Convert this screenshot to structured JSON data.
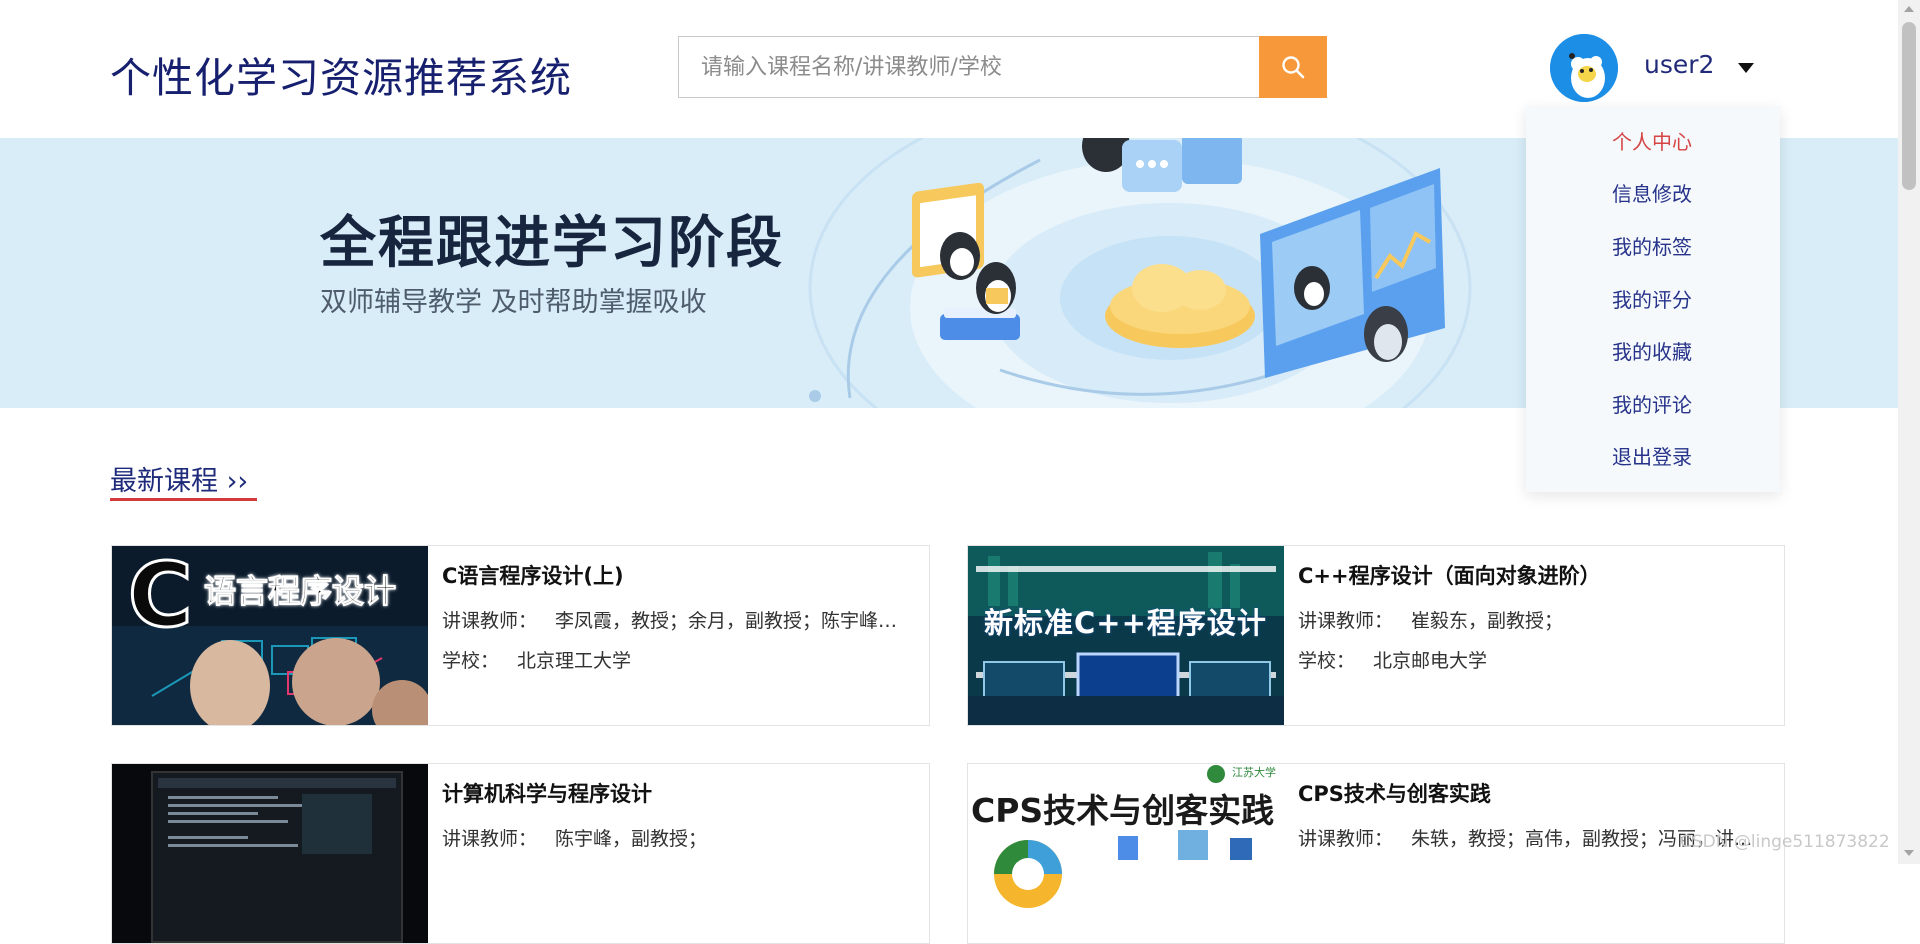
{
  "header": {
    "site_title": "个性化学习资源推荐系统",
    "search_placeholder": "请输入课程名称/讲课教师/学校",
    "username": "user2"
  },
  "banner": {
    "headline": "全程跟进学习阶段",
    "subline": "双师辅导教学 及时帮助掌握吸收"
  },
  "user_menu": {
    "items": [
      {
        "label": "个人中心",
        "active": true
      },
      {
        "label": "信息修改"
      },
      {
        "label": "我的标签"
      },
      {
        "label": "我的评分"
      },
      {
        "label": "我的收藏"
      },
      {
        "label": "我的评论"
      },
      {
        "label": "退出登录"
      }
    ]
  },
  "section": {
    "title": "最新课程 ››"
  },
  "labels": {
    "teacher": "讲课教师：",
    "school": "学校："
  },
  "courses": [
    {
      "name": "C语言程序设计(上)",
      "teachers": "李凤霞，教授；余月，副教授；陈宇峰，...",
      "school": "北京理工大学",
      "thumb_text": "语言程序设计",
      "thumb_letter": "C"
    },
    {
      "name": "C++程序设计（面向对象进阶）",
      "teachers": "崔毅东，副教授；",
      "school": "北京邮电大学",
      "thumb_text": "新标准C++程序设计"
    },
    {
      "name": "计算机科学与程序设计",
      "teachers": "陈宇峰，副教授；",
      "school": ""
    },
    {
      "name": "CPS技术与创客实践",
      "teachers": "朱轶，教授；高伟，副教授；冯丽，讲...",
      "school": "",
      "thumb_text": "CPS技术与创客实践",
      "thumb_badge": "江苏大学"
    }
  ],
  "watermark": "CSDN @linge511873822",
  "colors": {
    "title": "#17206f",
    "search_button": "#f7993a",
    "banner_bg": "#d8edf8",
    "menu_active": "#d64545",
    "menu_item": "#27338a",
    "section_underline": "#d33a3a"
  },
  "icons": {
    "search": "search-icon",
    "avatar": "penguin-avatar",
    "caret": "caret-down-icon"
  }
}
